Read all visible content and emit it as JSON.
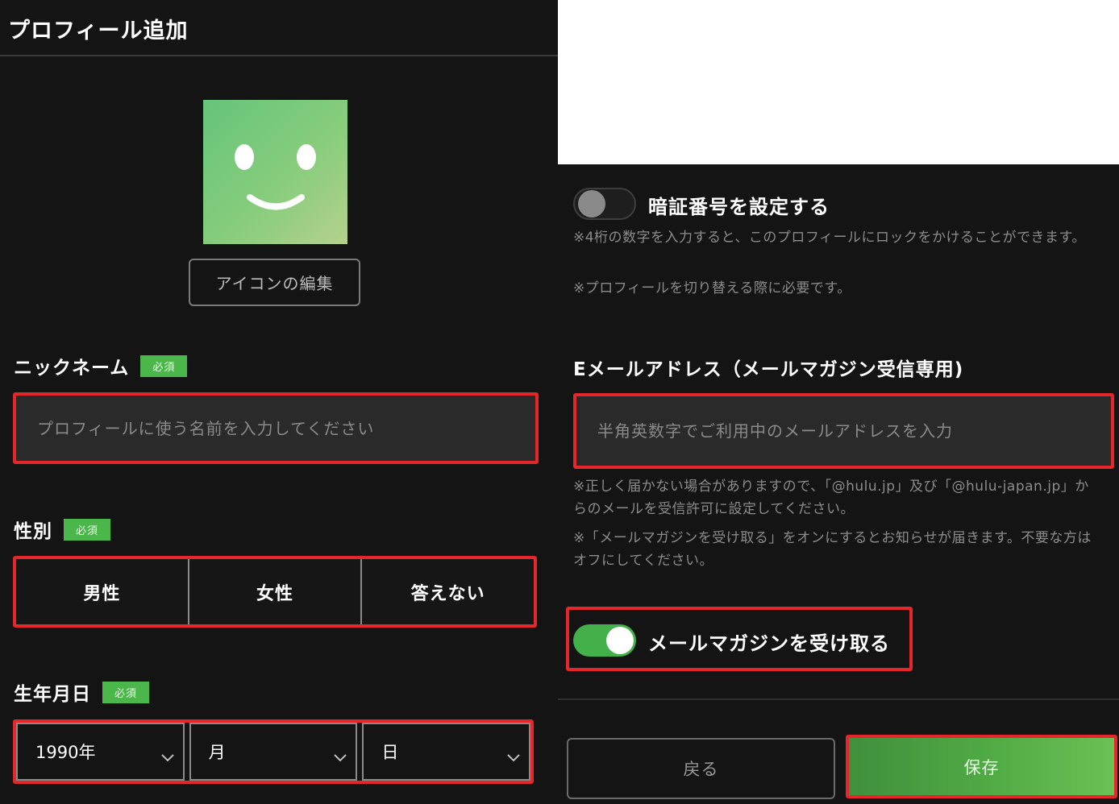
{
  "header": {
    "title": "プロフィール追加"
  },
  "avatar": {
    "icon": "smiley-face-icon",
    "edit_label": "アイコンの編集"
  },
  "nickname": {
    "label": "ニックネーム",
    "required": "必須",
    "placeholder": "プロフィールに使う名前を入力してください",
    "value": ""
  },
  "gender": {
    "label": "性別",
    "required": "必須",
    "options": [
      "男性",
      "女性",
      "答えない"
    ]
  },
  "birthday": {
    "label": "生年月日",
    "required": "必須",
    "year": "1990年",
    "month": "月",
    "day": "日"
  },
  "pin": {
    "label": "暗証番号を設定する",
    "enabled": false,
    "note_1": "※4桁の数字を入力すると、このプロフィールにロックをかけることができます。",
    "note_2": "※プロフィールを切り替える際に必要です。"
  },
  "email": {
    "label": "Eメールアドレス（メールマガジン受信専用)",
    "placeholder": "半角英数字でご利用中のメールアドレスを入力",
    "value": "",
    "note_1": "※正しく届かない場合がありますので、「@hulu.jp」及び「@hulu-japan.jp」からのメールを受信許可に設定してください。",
    "note_2": "※「メールマガジンを受け取る」をオンにするとお知らせが届きます。不要な方はオフにしてください。"
  },
  "newsletter": {
    "label": "メールマガジンを受け取る",
    "enabled": true
  },
  "footer": {
    "back_label": "戻る",
    "save_label": "保存"
  },
  "colors": {
    "background": "#141414",
    "accent_green": "#4bb64a",
    "highlight_red": "#e5262a",
    "input_background": "#2a2a2a"
  }
}
